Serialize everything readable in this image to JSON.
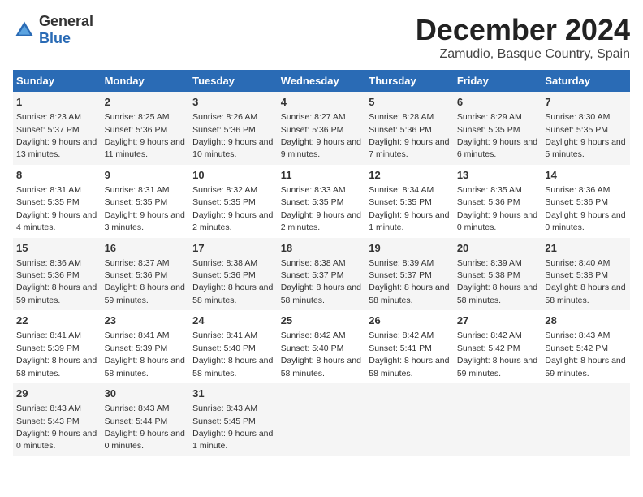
{
  "header": {
    "logo_general": "General",
    "logo_blue": "Blue",
    "title": "December 2024",
    "subtitle": "Zamudio, Basque Country, Spain"
  },
  "columns": [
    "Sunday",
    "Monday",
    "Tuesday",
    "Wednesday",
    "Thursday",
    "Friday",
    "Saturday"
  ],
  "rows": [
    [
      {
        "day": "1",
        "sunrise": "Sunrise: 8:23 AM",
        "sunset": "Sunset: 5:37 PM",
        "daylight": "Daylight: 9 hours and 13 minutes."
      },
      {
        "day": "2",
        "sunrise": "Sunrise: 8:25 AM",
        "sunset": "Sunset: 5:36 PM",
        "daylight": "Daylight: 9 hours and 11 minutes."
      },
      {
        "day": "3",
        "sunrise": "Sunrise: 8:26 AM",
        "sunset": "Sunset: 5:36 PM",
        "daylight": "Daylight: 9 hours and 10 minutes."
      },
      {
        "day": "4",
        "sunrise": "Sunrise: 8:27 AM",
        "sunset": "Sunset: 5:36 PM",
        "daylight": "Daylight: 9 hours and 9 minutes."
      },
      {
        "day": "5",
        "sunrise": "Sunrise: 8:28 AM",
        "sunset": "Sunset: 5:36 PM",
        "daylight": "Daylight: 9 hours and 7 minutes."
      },
      {
        "day": "6",
        "sunrise": "Sunrise: 8:29 AM",
        "sunset": "Sunset: 5:35 PM",
        "daylight": "Daylight: 9 hours and 6 minutes."
      },
      {
        "day": "7",
        "sunrise": "Sunrise: 8:30 AM",
        "sunset": "Sunset: 5:35 PM",
        "daylight": "Daylight: 9 hours and 5 minutes."
      }
    ],
    [
      {
        "day": "8",
        "sunrise": "Sunrise: 8:31 AM",
        "sunset": "Sunset: 5:35 PM",
        "daylight": "Daylight: 9 hours and 4 minutes."
      },
      {
        "day": "9",
        "sunrise": "Sunrise: 8:31 AM",
        "sunset": "Sunset: 5:35 PM",
        "daylight": "Daylight: 9 hours and 3 minutes."
      },
      {
        "day": "10",
        "sunrise": "Sunrise: 8:32 AM",
        "sunset": "Sunset: 5:35 PM",
        "daylight": "Daylight: 9 hours and 2 minutes."
      },
      {
        "day": "11",
        "sunrise": "Sunrise: 8:33 AM",
        "sunset": "Sunset: 5:35 PM",
        "daylight": "Daylight: 9 hours and 2 minutes."
      },
      {
        "day": "12",
        "sunrise": "Sunrise: 8:34 AM",
        "sunset": "Sunset: 5:35 PM",
        "daylight": "Daylight: 9 hours and 1 minute."
      },
      {
        "day": "13",
        "sunrise": "Sunrise: 8:35 AM",
        "sunset": "Sunset: 5:36 PM",
        "daylight": "Daylight: 9 hours and 0 minutes."
      },
      {
        "day": "14",
        "sunrise": "Sunrise: 8:36 AM",
        "sunset": "Sunset: 5:36 PM",
        "daylight": "Daylight: 9 hours and 0 minutes."
      }
    ],
    [
      {
        "day": "15",
        "sunrise": "Sunrise: 8:36 AM",
        "sunset": "Sunset: 5:36 PM",
        "daylight": "Daylight: 8 hours and 59 minutes."
      },
      {
        "day": "16",
        "sunrise": "Sunrise: 8:37 AM",
        "sunset": "Sunset: 5:36 PM",
        "daylight": "Daylight: 8 hours and 59 minutes."
      },
      {
        "day": "17",
        "sunrise": "Sunrise: 8:38 AM",
        "sunset": "Sunset: 5:36 PM",
        "daylight": "Daylight: 8 hours and 58 minutes."
      },
      {
        "day": "18",
        "sunrise": "Sunrise: 8:38 AM",
        "sunset": "Sunset: 5:37 PM",
        "daylight": "Daylight: 8 hours and 58 minutes."
      },
      {
        "day": "19",
        "sunrise": "Sunrise: 8:39 AM",
        "sunset": "Sunset: 5:37 PM",
        "daylight": "Daylight: 8 hours and 58 minutes."
      },
      {
        "day": "20",
        "sunrise": "Sunrise: 8:39 AM",
        "sunset": "Sunset: 5:38 PM",
        "daylight": "Daylight: 8 hours and 58 minutes."
      },
      {
        "day": "21",
        "sunrise": "Sunrise: 8:40 AM",
        "sunset": "Sunset: 5:38 PM",
        "daylight": "Daylight: 8 hours and 58 minutes."
      }
    ],
    [
      {
        "day": "22",
        "sunrise": "Sunrise: 8:41 AM",
        "sunset": "Sunset: 5:39 PM",
        "daylight": "Daylight: 8 hours and 58 minutes."
      },
      {
        "day": "23",
        "sunrise": "Sunrise: 8:41 AM",
        "sunset": "Sunset: 5:39 PM",
        "daylight": "Daylight: 8 hours and 58 minutes."
      },
      {
        "day": "24",
        "sunrise": "Sunrise: 8:41 AM",
        "sunset": "Sunset: 5:40 PM",
        "daylight": "Daylight: 8 hours and 58 minutes."
      },
      {
        "day": "25",
        "sunrise": "Sunrise: 8:42 AM",
        "sunset": "Sunset: 5:40 PM",
        "daylight": "Daylight: 8 hours and 58 minutes."
      },
      {
        "day": "26",
        "sunrise": "Sunrise: 8:42 AM",
        "sunset": "Sunset: 5:41 PM",
        "daylight": "Daylight: 8 hours and 58 minutes."
      },
      {
        "day": "27",
        "sunrise": "Sunrise: 8:42 AM",
        "sunset": "Sunset: 5:42 PM",
        "daylight": "Daylight: 8 hours and 59 minutes."
      },
      {
        "day": "28",
        "sunrise": "Sunrise: 8:43 AM",
        "sunset": "Sunset: 5:42 PM",
        "daylight": "Daylight: 8 hours and 59 minutes."
      }
    ],
    [
      {
        "day": "29",
        "sunrise": "Sunrise: 8:43 AM",
        "sunset": "Sunset: 5:43 PM",
        "daylight": "Daylight: 9 hours and 0 minutes."
      },
      {
        "day": "30",
        "sunrise": "Sunrise: 8:43 AM",
        "sunset": "Sunset: 5:44 PM",
        "daylight": "Daylight: 9 hours and 0 minutes."
      },
      {
        "day": "31",
        "sunrise": "Sunrise: 8:43 AM",
        "sunset": "Sunset: 5:45 PM",
        "daylight": "Daylight: 9 hours and 1 minute."
      },
      {
        "day": "",
        "sunrise": "",
        "sunset": "",
        "daylight": ""
      },
      {
        "day": "",
        "sunrise": "",
        "sunset": "",
        "daylight": ""
      },
      {
        "day": "",
        "sunrise": "",
        "sunset": "",
        "daylight": ""
      },
      {
        "day": "",
        "sunrise": "",
        "sunset": "",
        "daylight": ""
      }
    ]
  ]
}
